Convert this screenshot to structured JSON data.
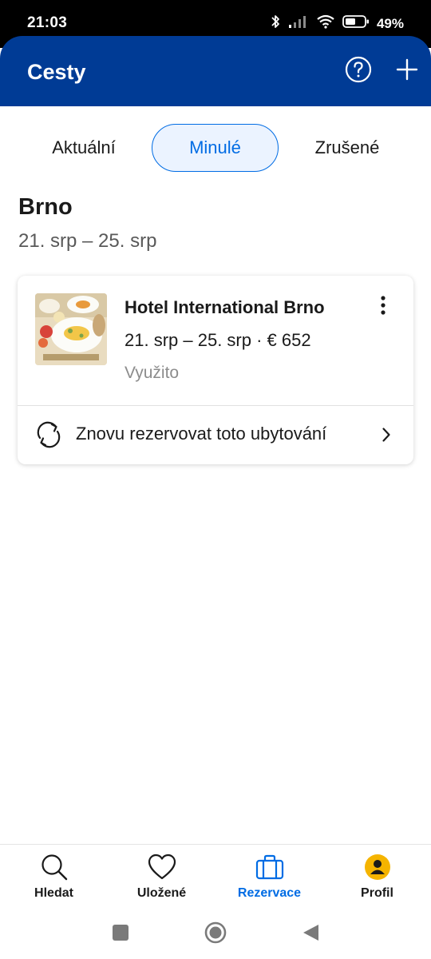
{
  "status_bar": {
    "time": "21:03",
    "battery_percent": "49%",
    "icons": [
      "bluetooth-icon",
      "signal-icon",
      "wifi-icon",
      "battery-icon"
    ]
  },
  "header": {
    "title": "Cesty",
    "help_icon": "question-circle-icon",
    "add_icon": "plus-icon",
    "background_color": "#003b95"
  },
  "tabs": [
    {
      "label": "Aktuální",
      "selected": false
    },
    {
      "label": "Minulé",
      "selected": true
    },
    {
      "label": "Zrušené",
      "selected": false
    }
  ],
  "trip": {
    "city": "Brno",
    "dates": "21. srp – 25. srp",
    "booking": {
      "hotel_name": "Hotel International Brno",
      "meta": "21. srp – 25. srp · € 652",
      "status": "Využito",
      "rebook_label": "Znovu rezervovat toto ubytování"
    }
  },
  "bottom_nav": [
    {
      "label": "Hledat",
      "icon": "search-icon",
      "active": false
    },
    {
      "label": "Uložené",
      "icon": "heart-icon",
      "active": false
    },
    {
      "label": "Rezervace",
      "icon": "suitcase-icon",
      "active": true
    },
    {
      "label": "Profil",
      "icon": "avatar-icon",
      "active": false
    }
  ],
  "colors": {
    "accent": "#006ce4",
    "brand": "#003b95",
    "selected_tab_bg": "#ebf3ff",
    "avatar": "#f5b400",
    "muted": "#8c8c8c"
  }
}
